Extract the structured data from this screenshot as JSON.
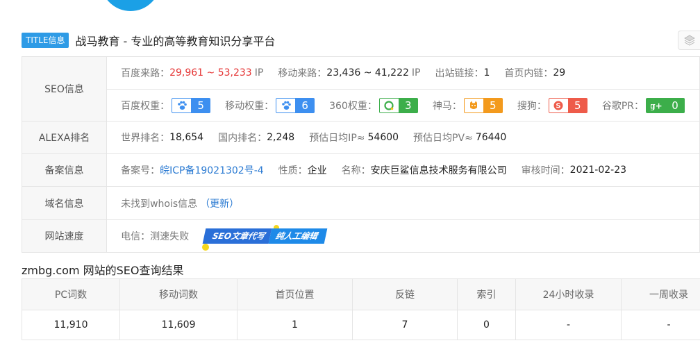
{
  "title_badge": "TITLE信息",
  "site_title": "战马教育 - 专业的高等教育知识分享平台",
  "seo": {
    "label": "SEO信息",
    "baidu_traffic_label": "百度来路：",
    "baidu_traffic_value": "29,961 ~ 53,233",
    "baidu_traffic_unit": "IP",
    "mobile_traffic_label": "移动来路：",
    "mobile_traffic_value": "23,436 ~ 41,222",
    "mobile_traffic_unit": "IP",
    "outlinks_label": "出站链接：",
    "outlinks_value": "1",
    "homepage_links_label": "首页内链：",
    "homepage_links_value": "29",
    "weights": [
      {
        "label": "百度权重：",
        "value": "5",
        "icon": "baidu-paw-icon",
        "color": "#3d8ff0"
      },
      {
        "label": "移动权重：",
        "value": "6",
        "icon": "baidu-paw-icon",
        "color": "#3d8ff0"
      },
      {
        "label": "360权重：",
        "value": "3",
        "icon": "360-icon",
        "color": "#3cae4a"
      },
      {
        "label": "神马：",
        "value": "5",
        "icon": "shenma-icon",
        "color": "#f39a1d"
      },
      {
        "label": "搜狗：",
        "value": "5",
        "icon": "sogou-icon",
        "color": "#ee5b4a"
      },
      {
        "label": "谷歌PR：",
        "value": "0",
        "icon": "google-plus-icon",
        "color": "#3cae4a"
      }
    ]
  },
  "alexa": {
    "label": "ALEXA排名",
    "world_label": "世界排名：",
    "world_value": "18,654",
    "domestic_label": "国内排名：",
    "domestic_value": "2,248",
    "ip_label": "预估日均IP≈",
    "ip_value": "54600",
    "pv_label": "预估日均PV≈",
    "pv_value": "76440"
  },
  "icp": {
    "label": "备案信息",
    "number_label": "备案号：",
    "number_value": "皖ICP备19021302号-4",
    "nature_label": "性质：",
    "nature_value": "企业",
    "name_label": "名称：",
    "name_value": "安庆巨鲨信息技术服务有限公司",
    "date_label": "审核时间：",
    "date_value": "2021-02-23"
  },
  "domain": {
    "label": "域名信息",
    "text": "未找到whois信息",
    "update_link": "（更新）"
  },
  "speed": {
    "label": "网站速度",
    "text": "电信：测速失败",
    "ad_part1": "SEO文章代写",
    "ad_part2": "纯人工编辑"
  },
  "result_title": "zmbg.com 网站的SEO查询结果",
  "results": {
    "headers": [
      "PC词数",
      "移动词数",
      "首页位置",
      "反链",
      "索引",
      "24小时收录",
      "一周收录"
    ],
    "row": [
      "11,910",
      "11,609",
      "1",
      "7",
      "0",
      "-",
      "-"
    ]
  },
  "colors": {
    "accent": "#2e9be6",
    "red": "#e53333",
    "link": "#2a7ad2"
  }
}
